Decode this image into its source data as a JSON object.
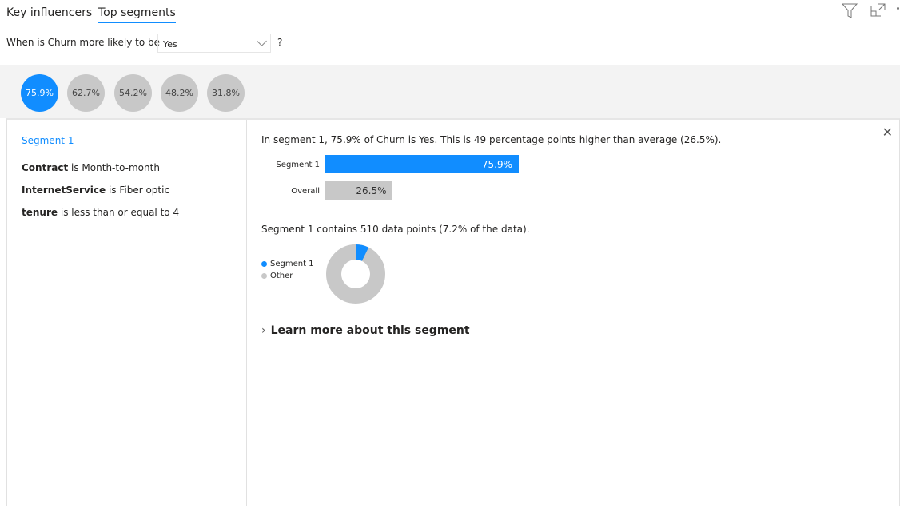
{
  "tabs": [
    {
      "label": "Key influencers"
    },
    {
      "label": "Top segments",
      "active": true
    }
  ],
  "question": {
    "label": "When is Churn more likely to be",
    "value": "Yes",
    "help": "?"
  },
  "segments": [
    {
      "label": "75.9%",
      "selected": true
    },
    {
      "label": "62.7%"
    },
    {
      "label": "54.2%"
    },
    {
      "label": "48.2%"
    },
    {
      "label": "31.8%"
    }
  ],
  "detail": {
    "title": "Segment 1",
    "conditions": [
      {
        "field": "Contract",
        "text": "is Month-to-month"
      },
      {
        "field": "InternetService",
        "text": "is Fiber optic"
      },
      {
        "field": "tenure",
        "text": "is less than or equal to 4"
      }
    ],
    "summary": "In segment 1, 75.9% of Churn is Yes. This is 49 percentage points higher than average (26.5%).",
    "bars": [
      {
        "label": "Segment 1",
        "value": 75.9,
        "text": "75.9%",
        "color": "#118dff"
      },
      {
        "label": "Overall",
        "value": 26.5,
        "text": "26.5%",
        "color": "#c8c8c8"
      }
    ],
    "contains": "Segment 1 contains 510 data points (7.2% of the data).",
    "donut": {
      "segment_pct": 7.2,
      "legend": [
        {
          "label": "Segment 1",
          "color": "#118dff"
        },
        {
          "label": "Other",
          "color": "#c8c8c8"
        }
      ]
    },
    "learn_more": "Learn more about this segment"
  }
}
